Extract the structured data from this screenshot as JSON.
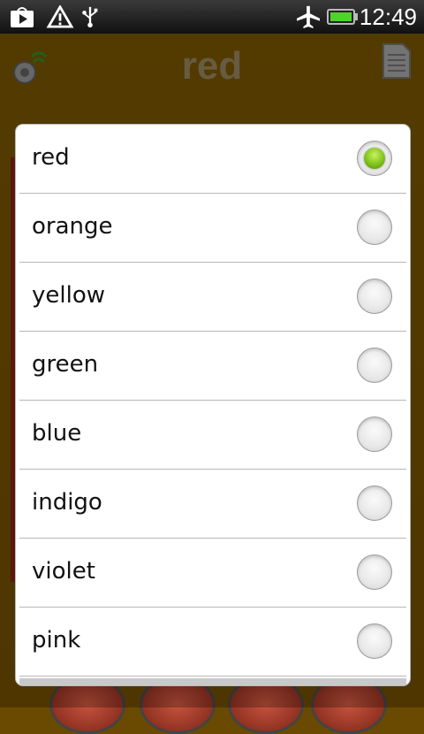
{
  "status_bar": {
    "time": "12:49",
    "icons": [
      "play-store-icon",
      "warning-icon",
      "usb-icon",
      "airplane-icon",
      "battery-icon"
    ]
  },
  "app": {
    "title": "red"
  },
  "dialog": {
    "options": [
      {
        "label": "red",
        "checked": true
      },
      {
        "label": "orange",
        "checked": false
      },
      {
        "label": "yellow",
        "checked": false
      },
      {
        "label": "green",
        "checked": false
      },
      {
        "label": "blue",
        "checked": false
      },
      {
        "label": "indigo",
        "checked": false
      },
      {
        "label": "violet",
        "checked": false
      },
      {
        "label": "pink",
        "checked": false
      }
    ]
  },
  "colors": {
    "background": "#6a4a00",
    "radio_selected": "#7fc31a",
    "app_title": "#8a7a58"
  }
}
